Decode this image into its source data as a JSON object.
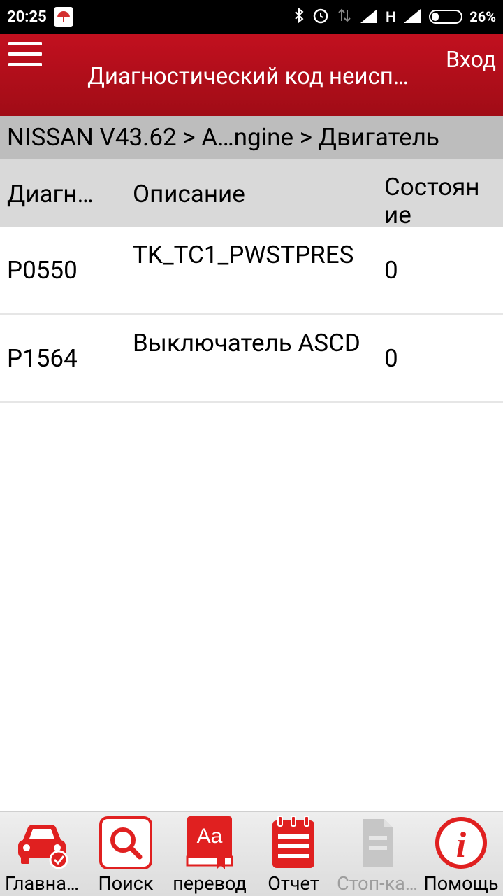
{
  "status_bar": {
    "time": "20:25",
    "network": "H",
    "battery": "26%"
  },
  "app_bar": {
    "title": "Диагностический код неисп…",
    "login_label": "Вход"
  },
  "breadcrumb": "NISSAN V43.62 > A…ngine > Двигатель",
  "table": {
    "headers": [
      "Диагн…",
      "Описание",
      "Состоян\nие"
    ],
    "rows": [
      {
        "code": "P0550",
        "description": "TK_TC1_PWSTPRES",
        "state": "0"
      },
      {
        "code": "P1564",
        "description": "Выключатель ASCD",
        "state": "0"
      }
    ]
  },
  "bottom_nav": [
    {
      "label": "Главна…",
      "icon": "car-check-icon"
    },
    {
      "label": "Поиск",
      "icon": "search-icon"
    },
    {
      "label": "перевод",
      "icon": "dictionary-icon"
    },
    {
      "label": "Отчет",
      "icon": "report-icon"
    },
    {
      "label": "Стоп-ка…",
      "icon": "freeze-frame-icon",
      "disabled": true
    },
    {
      "label": "Помощь",
      "icon": "info-icon"
    }
  ],
  "colors": {
    "accent": "#c2101f",
    "breadcrumb_bg": "#bdbdbd",
    "header_bg": "#d9d9d9"
  }
}
